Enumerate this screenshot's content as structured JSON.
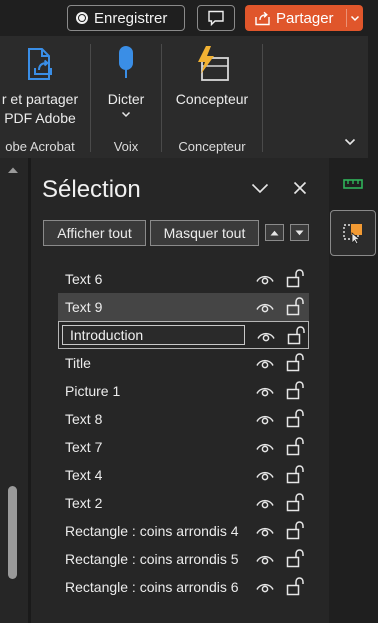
{
  "titlebar": {
    "record_label": "Enregistrer",
    "share_label": "Partager"
  },
  "ribbon": {
    "groups": [
      {
        "button_label_line1": "r et partager",
        "button_label_line2": "PDF Adobe",
        "group_label": "obe Acrobat",
        "icon": "share-pdf-icon"
      },
      {
        "button_label_line1": "Dicter",
        "group_label": "Voix",
        "icon": "microphone-icon"
      },
      {
        "button_label_line1": "Concepteur",
        "group_label": "Concepteur",
        "icon": "designer-icon"
      }
    ]
  },
  "pane": {
    "title": "Sélection",
    "show_all_label": "Afficher tout",
    "hide_all_label": "Masquer tout",
    "editing_value": "Introduction",
    "items": [
      {
        "name": "Text 6",
        "state": "normal"
      },
      {
        "name": "Text 9",
        "state": "selected"
      },
      {
        "name": "Introduction",
        "state": "editing"
      },
      {
        "name": "Title",
        "state": "normal"
      },
      {
        "name": "Picture 1",
        "state": "normal"
      },
      {
        "name": "Text 8",
        "state": "normal"
      },
      {
        "name": "Text 7",
        "state": "normal"
      },
      {
        "name": "Text 4",
        "state": "normal"
      },
      {
        "name": "Text 2",
        "state": "normal"
      },
      {
        "name": "Rectangle : coins arrondis 4",
        "state": "normal"
      },
      {
        "name": "Rectangle : coins arrondis 5",
        "state": "normal"
      },
      {
        "name": "Rectangle : coins arrondis 6",
        "state": "normal"
      }
    ]
  },
  "colors": {
    "accent": "#e0562b",
    "background": "#262626",
    "selected_row": "#454545"
  }
}
